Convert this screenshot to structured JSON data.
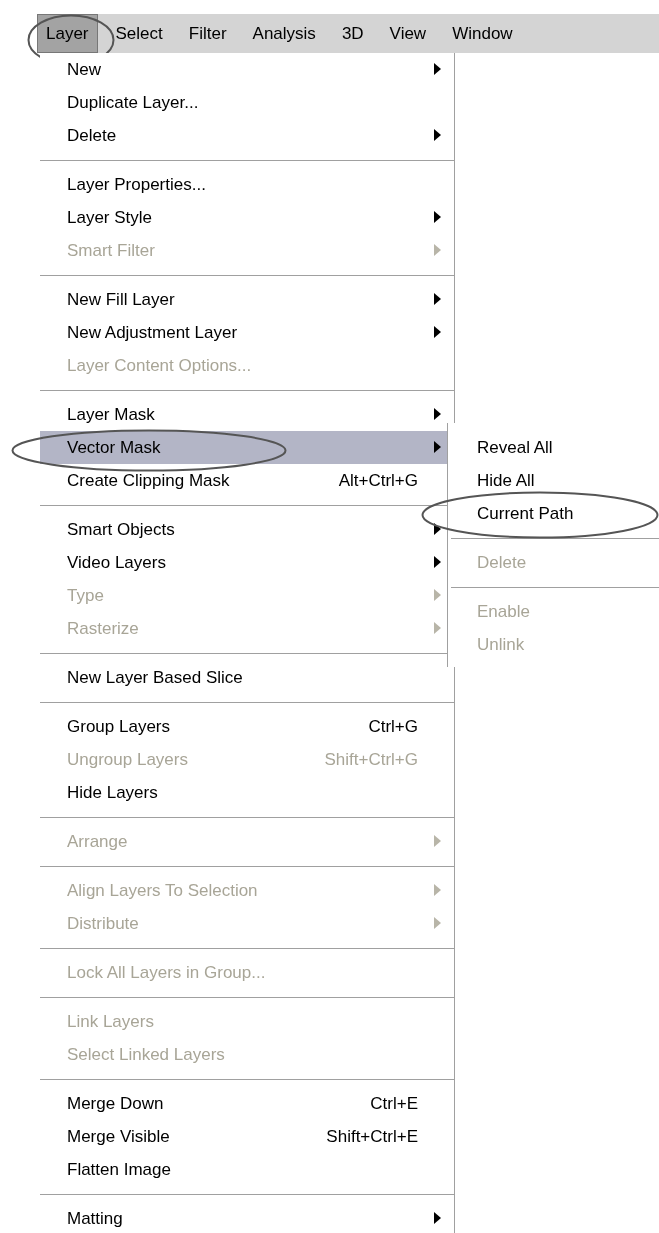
{
  "menubar": [
    {
      "label": "Layer",
      "selected": true,
      "circled": true
    },
    {
      "label": "Select",
      "selected": false,
      "circled": false
    },
    {
      "label": "Filter",
      "selected": false,
      "circled": false
    },
    {
      "label": "Analysis",
      "selected": false,
      "circled": false
    },
    {
      "label": "3D",
      "selected": false,
      "circled": false
    },
    {
      "label": "View",
      "selected": false,
      "circled": false
    },
    {
      "label": "Window",
      "selected": false,
      "circled": false
    }
  ],
  "menu": {
    "groups": [
      [
        {
          "label": "New",
          "has_submenu": true,
          "disabled": false,
          "selected": false,
          "circled": false
        },
        {
          "label": "Duplicate Layer...",
          "has_submenu": false,
          "disabled": false,
          "selected": false,
          "circled": false
        },
        {
          "label": "Delete",
          "has_submenu": true,
          "disabled": false,
          "selected": false,
          "circled": false
        }
      ],
      [
        {
          "label": "Layer Properties...",
          "has_submenu": false,
          "disabled": false,
          "selected": false,
          "circled": false
        },
        {
          "label": "Layer Style",
          "has_submenu": true,
          "disabled": false,
          "selected": false,
          "circled": false
        },
        {
          "label": "Smart Filter",
          "has_submenu": true,
          "disabled": true,
          "selected": false,
          "circled": false
        }
      ],
      [
        {
          "label": "New Fill Layer",
          "has_submenu": true,
          "disabled": false,
          "selected": false,
          "circled": false
        },
        {
          "label": "New Adjustment Layer",
          "has_submenu": true,
          "disabled": false,
          "selected": false,
          "circled": false
        },
        {
          "label": "Layer Content Options...",
          "has_submenu": false,
          "disabled": true,
          "selected": false,
          "circled": false
        }
      ],
      [
        {
          "label": "Layer Mask",
          "has_submenu": true,
          "disabled": false,
          "selected": false,
          "circled": false
        },
        {
          "label": "Vector Mask",
          "has_submenu": true,
          "disabled": false,
          "selected": true,
          "circled": true,
          "submenu": {
            "groups": [
              [
                {
                  "label": "Reveal All",
                  "disabled": false,
                  "circled": false
                },
                {
                  "label": "Hide All",
                  "disabled": false,
                  "circled": false
                },
                {
                  "label": "Current Path",
                  "disabled": false,
                  "circled": true
                }
              ],
              [
                {
                  "label": "Delete",
                  "disabled": true,
                  "circled": false
                }
              ],
              [
                {
                  "label": "Enable",
                  "disabled": true,
                  "circled": false
                },
                {
                  "label": "Unlink",
                  "disabled": true,
                  "circled": false
                }
              ]
            ]
          }
        },
        {
          "label": "Create Clipping Mask",
          "shortcut": "Alt+Ctrl+G",
          "has_submenu": false,
          "disabled": false,
          "selected": false,
          "circled": false
        }
      ],
      [
        {
          "label": "Smart Objects",
          "has_submenu": true,
          "disabled": false,
          "selected": false,
          "circled": false
        },
        {
          "label": "Video Layers",
          "has_submenu": true,
          "disabled": false,
          "selected": false,
          "circled": false
        },
        {
          "label": "Type",
          "has_submenu": true,
          "disabled": true,
          "selected": false,
          "circled": false
        },
        {
          "label": "Rasterize",
          "has_submenu": true,
          "disabled": true,
          "selected": false,
          "circled": false
        }
      ],
      [
        {
          "label": "New Layer Based Slice",
          "has_submenu": false,
          "disabled": false,
          "selected": false,
          "circled": false
        }
      ],
      [
        {
          "label": "Group Layers",
          "shortcut": "Ctrl+G",
          "has_submenu": false,
          "disabled": false,
          "selected": false,
          "circled": false
        },
        {
          "label": "Ungroup Layers",
          "shortcut": "Shift+Ctrl+G",
          "has_submenu": false,
          "disabled": true,
          "selected": false,
          "circled": false
        },
        {
          "label": "Hide Layers",
          "has_submenu": false,
          "disabled": false,
          "selected": false,
          "circled": false
        }
      ],
      [
        {
          "label": "Arrange",
          "has_submenu": true,
          "disabled": true,
          "selected": false,
          "circled": false
        }
      ],
      [
        {
          "label": "Align Layers To Selection",
          "has_submenu": true,
          "disabled": true,
          "selected": false,
          "circled": false
        },
        {
          "label": "Distribute",
          "has_submenu": true,
          "disabled": true,
          "selected": false,
          "circled": false
        }
      ],
      [
        {
          "label": "Lock All Layers in Group...",
          "has_submenu": false,
          "disabled": true,
          "selected": false,
          "circled": false
        }
      ],
      [
        {
          "label": "Link Layers",
          "has_submenu": false,
          "disabled": true,
          "selected": false,
          "circled": false
        },
        {
          "label": "Select Linked Layers",
          "has_submenu": false,
          "disabled": true,
          "selected": false,
          "circled": false
        }
      ],
      [
        {
          "label": "Merge Down",
          "shortcut": "Ctrl+E",
          "has_submenu": false,
          "disabled": false,
          "selected": false,
          "circled": false
        },
        {
          "label": "Merge Visible",
          "shortcut": "Shift+Ctrl+E",
          "has_submenu": false,
          "disabled": false,
          "selected": false,
          "circled": false
        },
        {
          "label": "Flatten Image",
          "has_submenu": false,
          "disabled": false,
          "selected": false,
          "circled": false
        }
      ],
      [
        {
          "label": "Matting",
          "has_submenu": true,
          "disabled": false,
          "selected": false,
          "circled": false
        }
      ]
    ]
  }
}
